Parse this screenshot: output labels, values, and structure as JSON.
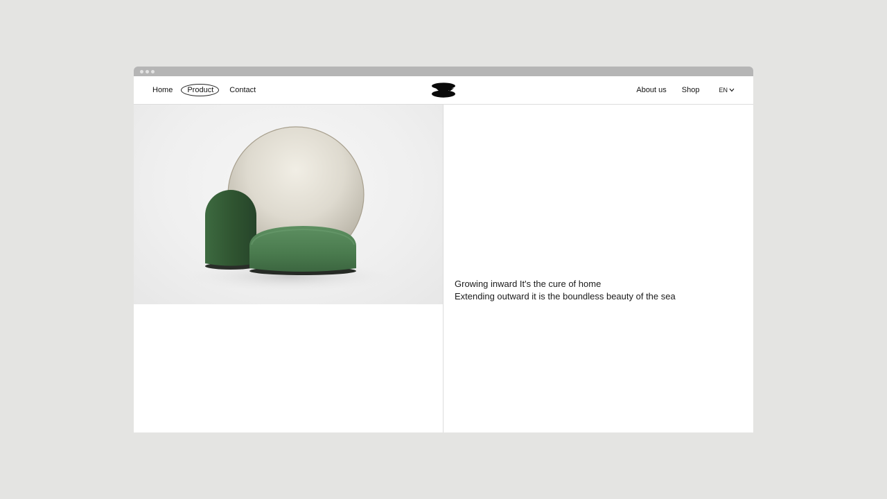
{
  "nav": {
    "left": [
      {
        "label": "Home"
      },
      {
        "label": "Product"
      },
      {
        "label": "Contact"
      }
    ],
    "right": [
      {
        "label": "About us"
      },
      {
        "label": "Shop"
      }
    ],
    "language": {
      "label": "EN",
      "icon": "chevron-down-icon"
    },
    "logo_icon": "brand-logo-icon"
  },
  "hero": {
    "image_icon": "product-photo",
    "colors": {
      "green": "#3f6e44",
      "dark_green": "#2d4d2c",
      "sphere": "#ddd9cf"
    },
    "tagline_line1": "Growing inward It's the cure of home",
    "tagline_line2": "Extending outward it is the boundless beauty of the sea"
  },
  "colors": {
    "background": "#e4e4e2",
    "titlebar": "#b5b5b5",
    "divider": "#dcdcdc"
  }
}
